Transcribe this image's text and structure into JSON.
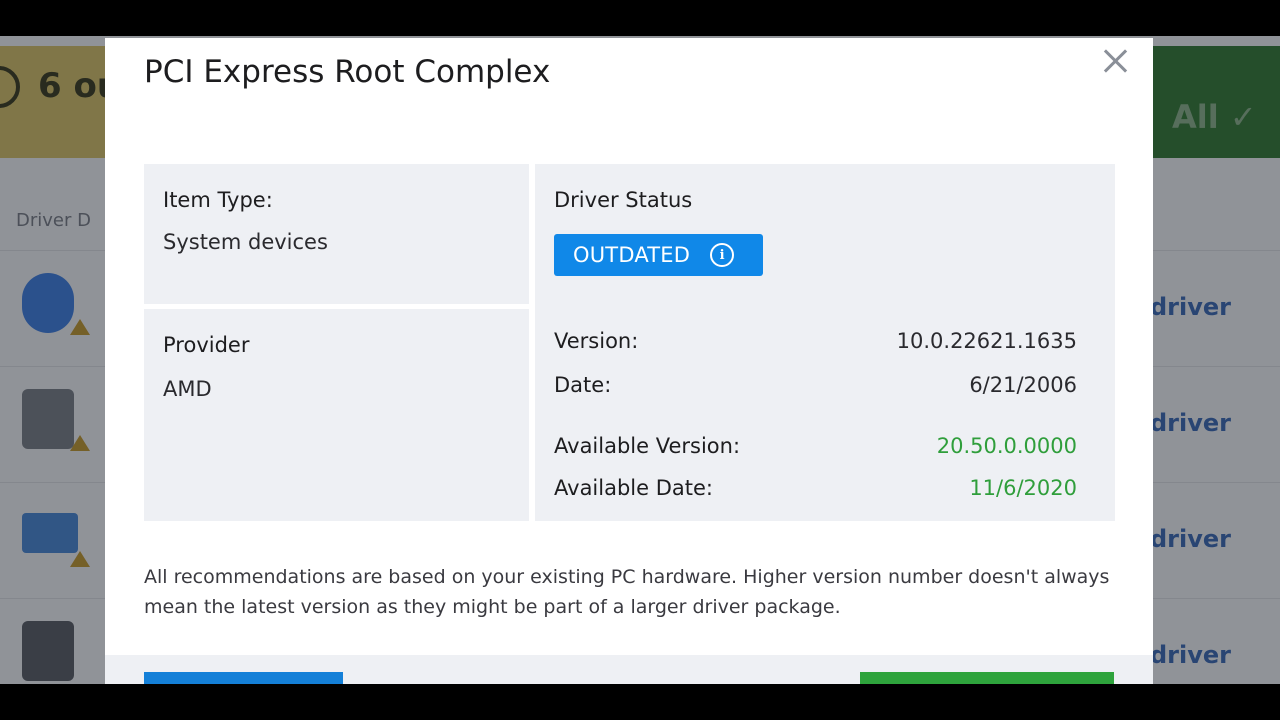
{
  "background": {
    "banner_text": "6 ou",
    "fix_all_label": "All ✓",
    "section_label": "Driver D",
    "row_link_label": "driver"
  },
  "modal": {
    "title": "PCI Express Root Complex",
    "item_type": {
      "label": "Item Type:",
      "value": "System devices"
    },
    "provider": {
      "label": "Provider",
      "value": "AMD"
    },
    "driver_status": {
      "label": "Driver Status",
      "badge": "OUTDATED",
      "badge_icon": "info-icon"
    },
    "details": {
      "version_label": "Version:",
      "version_value": "10.0.22621.1635",
      "date_label": "Date:",
      "date_value": "6/21/2006",
      "available_version_label": "Available Version:",
      "available_version_value": "20.50.0.0000",
      "available_date_label": "Available Date:",
      "available_date_value": "11/6/2020"
    },
    "note": "All recommendations are based on your existing PC hardware. Higher version number doesn't always mean the latest version as they might be part of a larger driver package."
  },
  "colors": {
    "badge_blue": "#1088e8",
    "available_green": "#2f9e3b",
    "panel_bg": "#eef0f4",
    "footer_blue_button": "#1480d8",
    "footer_green_button": "#2ea33c"
  }
}
